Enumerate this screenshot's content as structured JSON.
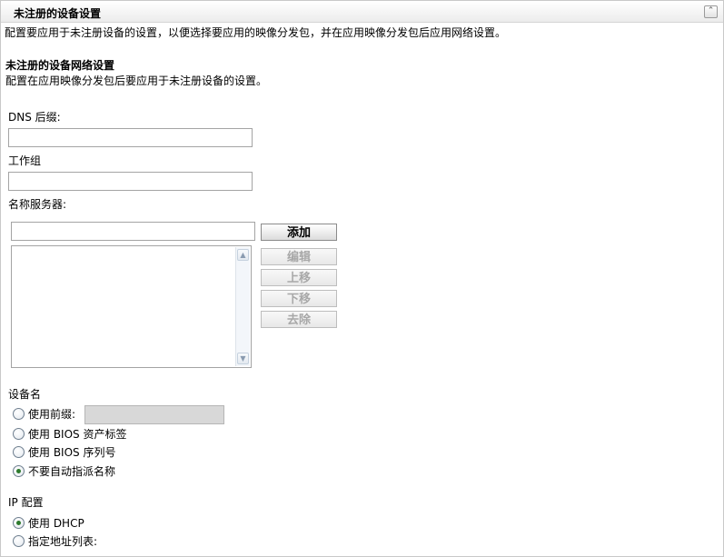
{
  "panel": {
    "title": "未注册的设备设置",
    "collapse_glyph": "⌃",
    "description": "配置要应用于未注册设备的设置，以便选择要应用的映像分发包，并在应用映像分发包后应用网络设置。"
  },
  "network": {
    "heading": "未注册的设备网络设置",
    "description": "配置在应用映像分发包后要应用于未注册设备的设置。",
    "dns_label": "DNS 后缀:",
    "dns_value": "",
    "workgroup_label": "工作组",
    "workgroup_value": "",
    "nameserver_label": "名称服务器:",
    "nameserver_input_value": "",
    "nameserver_list": [],
    "buttons": {
      "add": "添加",
      "edit": "编辑",
      "move_up": "上移",
      "move_down": "下移",
      "remove": "去除"
    }
  },
  "device_name": {
    "label": "设备名",
    "options": [
      {
        "label": "使用前缀:",
        "checked": false
      },
      {
        "label": "使用 BIOS 资产标签",
        "checked": false
      },
      {
        "label": "使用 BIOS 序列号",
        "checked": false
      },
      {
        "label": "不要自动指派名称",
        "checked": true
      }
    ],
    "prefix_value": ""
  },
  "ip_config": {
    "label": "IP 配置",
    "options": [
      {
        "label": "使用 DHCP",
        "checked": true
      },
      {
        "label": "指定地址列表:",
        "checked": false
      }
    ]
  },
  "colors": {
    "radio_dot": "#2d7a2d",
    "disabled_text": "#a8a8a8"
  }
}
